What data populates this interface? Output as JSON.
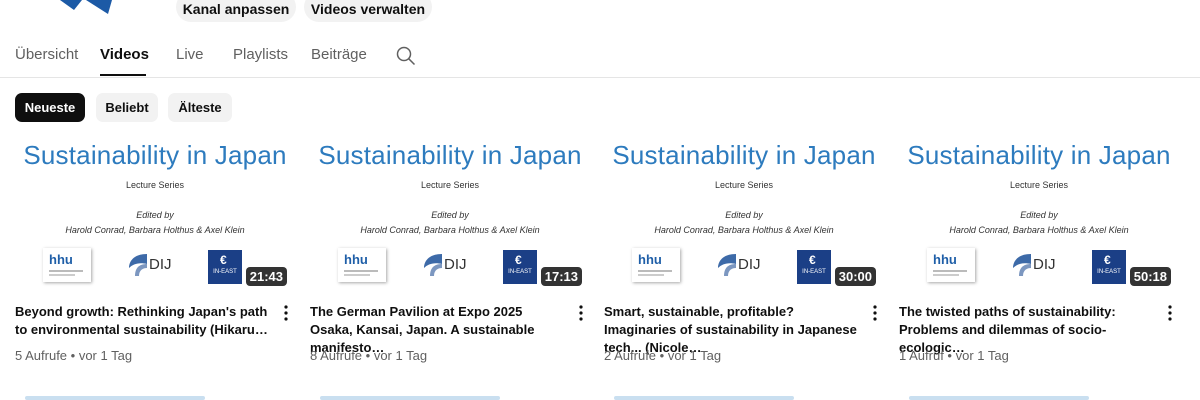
{
  "header": {
    "buttons": [
      {
        "label": "Kanal anpassen"
      },
      {
        "label": "Videos verwalten"
      }
    ],
    "brand_color": "#1c5aa6"
  },
  "tabs": [
    {
      "label": "Übersicht",
      "active": false
    },
    {
      "label": "Videos",
      "active": true
    },
    {
      "label": "Live",
      "active": false
    },
    {
      "label": "Playlists",
      "active": false
    },
    {
      "label": "Beiträge",
      "active": false
    }
  ],
  "tabs_search_icon": "search-icon",
  "filters": [
    {
      "label": "Neueste",
      "active": true
    },
    {
      "label": "Beliebt",
      "active": false
    },
    {
      "label": "Älteste",
      "active": false
    }
  ],
  "thumbnail": {
    "title": "Sustainability in Japan",
    "subtitle": "Lecture Series",
    "edited_by": "Edited by",
    "editors": "Harold Conrad, Barbara Holthus & Axel Klein",
    "logos": {
      "hhu": "hhu",
      "dij": "DIJ",
      "ineast": "IN-EAST"
    },
    "title_color": "#2d7bbe"
  },
  "videos": [
    {
      "duration": "21:43",
      "title": "Beyond growth: Rethinking Japan's path to environmental sustainability (Hikaru…",
      "stats": "5 Aufrufe • vor 1 Tag"
    },
    {
      "duration": "17:13",
      "title": "The German Pavilion at Expo 2025 Osaka, Kansai, Japan. A sustainable manifesto…",
      "stats": "8 Aufrufe • vor 1 Tag"
    },
    {
      "duration": "30:00",
      "title": "Smart, sustainable, profitable? Imaginaries of sustainability in Japanese tech... (Nicole…",
      "stats": "2 Aufrufe • vor 1 Tag"
    },
    {
      "duration": "50:18",
      "title": "The twisted paths of sustainability: Problems and dilemmas of socio-ecologic…",
      "stats": "1 Aufruf • vor 1 Tag"
    }
  ]
}
